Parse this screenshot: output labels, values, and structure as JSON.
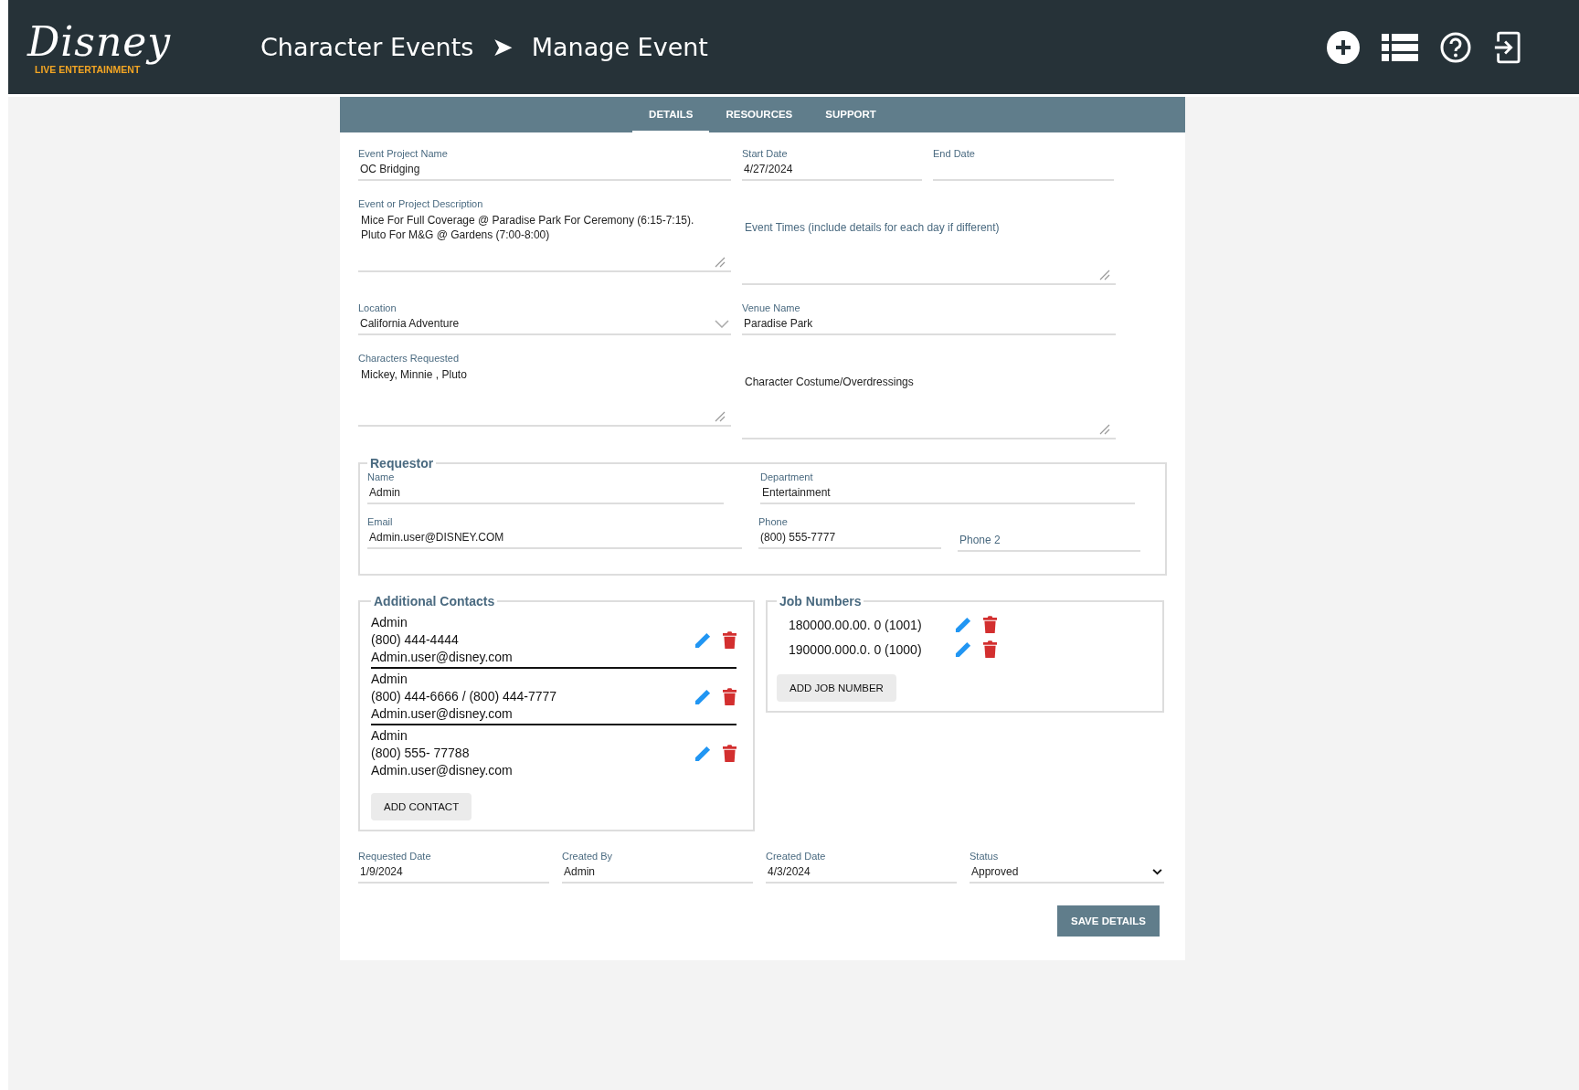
{
  "header": {
    "logo": {
      "wordmark": "Disney",
      "tagline": "LIVE ENTERTAINMENT"
    },
    "breadcrumb": [
      "Character Events",
      "Manage Event"
    ],
    "separator": "➤"
  },
  "tabs": [
    {
      "label": "DETAILS",
      "selected": true
    },
    {
      "label": "RESOURCES",
      "selected": false
    },
    {
      "label": "SUPPORT",
      "selected": false
    }
  ],
  "form": {
    "rows": [
      {
        "fields": [
          {
            "kind": "input",
            "label": "Event Project Name",
            "value": "OC Bridging"
          },
          {
            "kind": "input",
            "label": "Start Date",
            "value": "4/27/2024"
          },
          {
            "kind": "input",
            "label": "End Date"
          }
        ]
      },
      {
        "fields": [
          {
            "kind": "textarea",
            "label": "Event or Project Description",
            "value": "Mice For Full Coverage @ Paradise Park For Ceremony (6:15-7:15).\nPluto For M&G @ Gardens (7:00-8:00)"
          },
          {
            "kind": "textarea",
            "placeholder": "Event Times (include details for each day if different)"
          }
        ]
      },
      {
        "fields": [
          {
            "kind": "select",
            "label": "Location",
            "value": "California Adventure"
          },
          {
            "kind": "input",
            "label": "Venue Name",
            "value": "Paradise Park"
          }
        ]
      },
      {
        "fields": [
          {
            "kind": "textarea",
            "label": "Characters Requested",
            "value": "Mickey, Minnie , Pluto"
          },
          {
            "kind": "textarea",
            "value": "Character Costume/Overdressings"
          }
        ]
      }
    ]
  },
  "requestor": {
    "title": "Requestor",
    "rows": [
      {
        "fields": [
          {
            "kind": "input",
            "label": "Name",
            "value": "Admin"
          },
          {
            "kind": "input",
            "label": "Department",
            "value": "Entertainment"
          }
        ]
      },
      {
        "fields": [
          {
            "kind": "input",
            "label": "Email",
            "value": "Admin.user@DISNEY.COM"
          },
          {
            "kind": "input",
            "label": "Phone",
            "value": "(800) 555-7777"
          },
          {
            "kind": "input",
            "placeholder": "Phone 2"
          }
        ]
      }
    ]
  },
  "additional_contacts": {
    "title": "Additional Contacts",
    "contacts": [
      {
        "name": "Admin",
        "phone": "(800) 444-4444",
        "email": "Admin.user@disney.com"
      },
      {
        "name": "Admin",
        "phone": "(800) 444-6666 / (800) 444-7777",
        "email": "Admin.user@disney.com"
      },
      {
        "name": "Admin",
        "phone": "(800) 555- 77788",
        "email": "Admin.user@disney.com"
      }
    ],
    "button": "ADD CONTACT"
  },
  "job_numbers": {
    "title": "Job Numbers",
    "items": [
      "180000.00.00. 0 (1001)",
      "190000.000.0. 0 (1000)"
    ],
    "button": "ADD JOB NUMBER"
  },
  "footer_fields": [
    {
      "kind": "input",
      "label": "Requested Date",
      "value": "1/9/2024"
    },
    {
      "kind": "input",
      "label": "Created By",
      "value": "Admin"
    },
    {
      "kind": "input",
      "label": "Created Date",
      "value": "4/3/2024"
    },
    {
      "kind": "select",
      "label": "Status",
      "value": "Approved"
    }
  ],
  "save_button": "SAVE DETAILS"
}
